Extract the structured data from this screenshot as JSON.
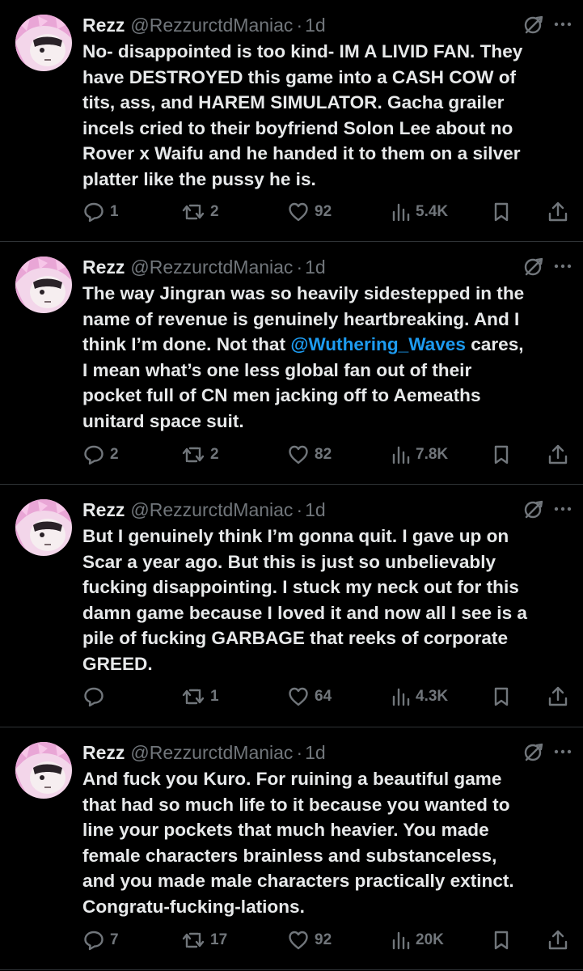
{
  "colors": {
    "background": "#000000",
    "text": "#e7e9ea",
    "muted": "#71767b",
    "accent": "#1d9bf0",
    "divider": "#2f3336",
    "avatar_pink": "#e9a6d6"
  },
  "icons": {
    "reply": "reply-icon",
    "retweet": "retweet-icon",
    "like": "heart-icon",
    "views": "views-icon",
    "bookmark": "bookmark-icon",
    "share": "share-icon",
    "grok": "grok-icon",
    "more": "more-icon"
  },
  "tweets": [
    {
      "name": "Rezz",
      "handle": "@RezzurctdManiac",
      "separator": "·",
      "time": "1d",
      "lines": [
        [
          {
            "text": "No- disappointed is too kind- IM A LIVID FAN. They"
          }
        ],
        [
          {
            "text": "have DESTROYED this game into a CASH COW of"
          }
        ],
        [
          {
            "text": "tits, ass, and HAREM SIMULATOR. Gacha grailer"
          }
        ],
        [
          {
            "text": "incels cried to their boyfriend Solon Lee about no"
          }
        ],
        [
          {
            "text": "Rover x Waifu and he handed it to them on a silver"
          }
        ],
        [
          {
            "text": "platter like the pussy he is."
          }
        ]
      ],
      "replies": "1",
      "retweets": "2",
      "likes": "92",
      "views": "5.4K"
    },
    {
      "name": "Rezz",
      "handle": "@RezzurctdManiac",
      "separator": "·",
      "time": "1d",
      "lines": [
        [
          {
            "text": "The way Jingran was so heavily sidestepped in the"
          }
        ],
        [
          {
            "text": "name of revenue is genuinely heartbreaking. And I"
          }
        ],
        [
          {
            "text": "think I’m done. Not that "
          },
          {
            "text": "@Wuthering_Waves",
            "mention": true
          },
          {
            "text": " cares,"
          }
        ],
        [
          {
            "text": "I mean what’s one less global fan out of their"
          }
        ],
        [
          {
            "text": "pocket full of CN men jacking off to Aemeaths"
          }
        ],
        [
          {
            "text": "unitard space suit."
          }
        ]
      ],
      "replies": "2",
      "retweets": "2",
      "likes": "82",
      "views": "7.8K"
    },
    {
      "name": "Rezz",
      "handle": "@RezzurctdManiac",
      "separator": "·",
      "time": "1d",
      "lines": [
        [
          {
            "text": "But I genuinely think I’m gonna quit. I gave up on"
          }
        ],
        [
          {
            "text": "Scar a year ago. But this is just so unbelievably"
          }
        ],
        [
          {
            "text": "fucking disappointing. I stuck my neck out for this"
          }
        ],
        [
          {
            "text": "damn game because I loved it and now all I see is a"
          }
        ],
        [
          {
            "text": "pile of fucking GARBAGE that reeks of corporate"
          }
        ],
        [
          {
            "text": "GREED."
          }
        ]
      ],
      "replies": "",
      "retweets": "1",
      "likes": "64",
      "views": "4.3K"
    },
    {
      "name": "Rezz",
      "handle": "@RezzurctdManiac",
      "separator": "·",
      "time": "1d",
      "lines": [
        [
          {
            "text": "And fuck you Kuro. For ruining a beautiful game"
          }
        ],
        [
          {
            "text": "that had so much life to it because you wanted to"
          }
        ],
        [
          {
            "text": "line your pockets that much heavier. You made"
          }
        ],
        [
          {
            "text": "female characters brainless and substanceless,"
          }
        ],
        [
          {
            "text": "and you made male characters practically extinct."
          }
        ],
        [
          {
            "text": "Congratu-fucking-lations."
          }
        ]
      ],
      "replies": "7",
      "retweets": "17",
      "likes": "92",
      "views": "20K"
    }
  ]
}
